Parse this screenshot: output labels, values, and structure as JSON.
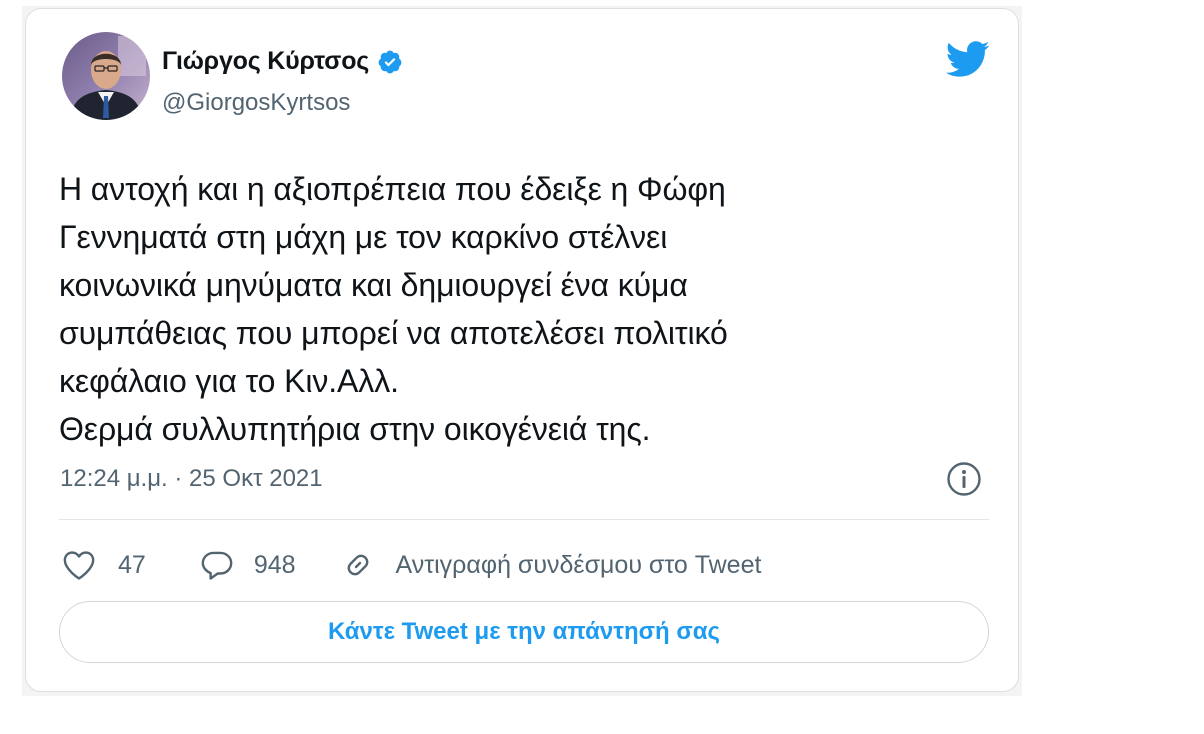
{
  "author": {
    "display_name": "Γιώργος Κύρτσος",
    "handle": "@GiorgosKyrtsos",
    "verified": true,
    "avatar_icon": "profile-photo"
  },
  "tweet": {
    "lines": [
      "Η αντοχή και η αξιοπρέπεια που έδειξε η Φώφη",
      "Γεννηματά στη μάχη με τον καρκίνο στέλνει",
      "κοινωνικά μηνύματα και δημιουργεί ένα κύμα",
      "συμπάθειας που μπορεί να αποτελέσει πολιτικό",
      "κεφάλαιο για το Κιν.Αλλ.",
      "Θερμά συλλυπητήρια στην οικογένειά της."
    ],
    "timestamp": "12:24 μ.μ. · 25 Οκτ 2021"
  },
  "actions": {
    "likes": "47",
    "replies": "948",
    "copy_link_label": "Αντιγραφή συνδέσμου στο Tweet"
  },
  "reply_button": {
    "label": "Κάντε Tweet με την απάντησή σας"
  },
  "icons": {
    "brand": "twitter-bird-icon",
    "verified": "verified-badge-icon",
    "info": "info-icon",
    "like": "heart-icon",
    "reply": "speech-bubble-icon",
    "link": "link-icon"
  },
  "colors": {
    "brand_blue": "#1d9bf0",
    "text": "#0f1419",
    "secondary_text": "#536471",
    "border": "#dcdfe2"
  }
}
